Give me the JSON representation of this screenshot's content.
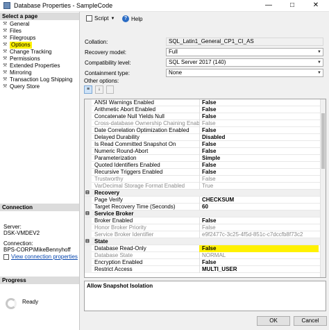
{
  "window": {
    "title": "Database Properties - SampleCode",
    "minimize": "—",
    "maximize": "□",
    "close": "✕"
  },
  "sidebar": {
    "header": "Select a page",
    "items": [
      {
        "label": "General"
      },
      {
        "label": "Files"
      },
      {
        "label": "Filegroups"
      },
      {
        "label": "Options",
        "selected": true
      },
      {
        "label": "Change Tracking"
      },
      {
        "label": "Permissions"
      },
      {
        "label": "Extended Properties"
      },
      {
        "label": "Mirroring"
      },
      {
        "label": "Transaction Log Shipping"
      },
      {
        "label": "Query Store"
      }
    ]
  },
  "connection": {
    "header": "Connection",
    "server_label": "Server:",
    "server": "DSK-VMDEV2",
    "connection_label": "Connection:",
    "connection": "BPS-CORP\\MikeBennyhoff",
    "link": "View connection properties"
  },
  "progress": {
    "header": "Progress",
    "status": "Ready"
  },
  "toolbar": {
    "script_label": "Script",
    "help_label": "Help"
  },
  "form": {
    "collation_label": "Collation:",
    "collation_value": "SQL_Latin1_General_CP1_CI_AS",
    "recovery_label": "Recovery model:",
    "recovery_value": "Full",
    "compat_label": "Compatibility level:",
    "compat_value": "SQL Server 2017 (140)",
    "containment_label": "Containment type:",
    "containment_value": "None",
    "other_label": "Other options:"
  },
  "grid": {
    "rows": [
      {
        "name": "ANSI Warnings Enabled",
        "value": "False",
        "kind": "bold"
      },
      {
        "name": "Arithmetic Abort Enabled",
        "value": "False",
        "kind": "bold"
      },
      {
        "name": "Concatenate Null Yields Null",
        "value": "False",
        "kind": "bold"
      },
      {
        "name": "Cross-database Ownership Chaining Enabled",
        "value": "False",
        "kind": "disabled"
      },
      {
        "name": "Date Correlation Optimization Enabled",
        "value": "False",
        "kind": "bold"
      },
      {
        "name": "Delayed Durability",
        "value": "Disabled",
        "kind": "bold"
      },
      {
        "name": "Is Read Committed Snapshot On",
        "value": "False",
        "kind": "bold"
      },
      {
        "name": "Numeric Round-Abort",
        "value": "False",
        "kind": "bold"
      },
      {
        "name": "Parameterization",
        "value": "Simple",
        "kind": "bold"
      },
      {
        "name": "Quoted Identifiers Enabled",
        "value": "False",
        "kind": "bold"
      },
      {
        "name": "Recursive Triggers Enabled",
        "value": "False",
        "kind": "bold"
      },
      {
        "name": "Trustworthy",
        "value": "False",
        "kind": "disabled"
      },
      {
        "name": "VarDecimal Storage Format Enabled",
        "value": "True",
        "kind": "disabled"
      },
      {
        "name": "Recovery",
        "value": "",
        "kind": "category",
        "toggle": "⊟"
      },
      {
        "name": "Page Verify",
        "value": "CHECKSUM",
        "kind": "bold"
      },
      {
        "name": "Target Recovery Time (Seconds)",
        "value": "60",
        "kind": "bold"
      },
      {
        "name": "Service Broker",
        "value": "",
        "kind": "category",
        "toggle": "⊟"
      },
      {
        "name": "Broker Enabled",
        "value": "False",
        "kind": "bold"
      },
      {
        "name": "Honor Broker Priority",
        "value": "False",
        "kind": "disabled"
      },
      {
        "name": "Service Broker Identifier",
        "value": "e9f2477c-3c25-4f5d-851c-c7dccfb8f73c2",
        "kind": "disabled"
      },
      {
        "name": "State",
        "value": "",
        "kind": "category",
        "toggle": "⊟"
      },
      {
        "name": "Database Read-Only",
        "value": "False",
        "kind": "bold",
        "highlight": true
      },
      {
        "name": "Database State",
        "value": "NORMAL",
        "kind": "disabled"
      },
      {
        "name": "Encryption Enabled",
        "value": "False",
        "kind": "bold"
      },
      {
        "name": "Restrict Access",
        "value": "MULTI_USER",
        "kind": "bold"
      }
    ]
  },
  "description": {
    "title": "Allow Snapshot Isolation"
  },
  "buttons": {
    "ok": "OK",
    "cancel": "Cancel"
  }
}
